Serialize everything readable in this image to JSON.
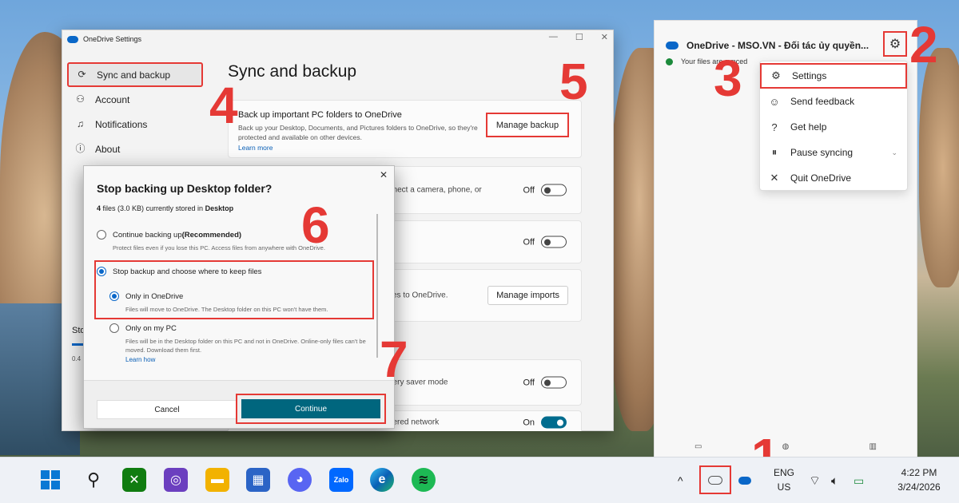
{
  "settings_window": {
    "title": "OneDrive Settings",
    "nav": [
      {
        "label": "Sync and backup",
        "icon": "sync-icon"
      },
      {
        "label": "Account",
        "icon": "person-icon"
      },
      {
        "label": "Notifications",
        "icon": "bell-icon"
      },
      {
        "label": "About",
        "icon": "info-icon"
      }
    ],
    "page_title": "Sync and backup",
    "backup_card": {
      "heading": "Back up important PC folders to OneDrive",
      "description": "Back up your Desktop, Documents, and Pictures folders to OneDrive, so they're protected and available on other devices.",
      "learn_more": "Learn more",
      "button": "Manage backup"
    },
    "rows": [
      {
        "text": "nnect a camera, phone, or",
        "state": "Off"
      },
      {
        "text": "",
        "state": "Off"
      },
      {
        "text": "ces to OneDrive.",
        "button": "Manage imports"
      },
      {
        "text": "ttery saver mode",
        "state": "Off"
      },
      {
        "text": "Pause syncing when this device is on a metered network",
        "state": "On"
      }
    ],
    "storage_label": "Sto",
    "storage_num": "0.4"
  },
  "dialog": {
    "title": "Stop backing up Desktop folder?",
    "info_count": "4",
    "info_rest": " files (3.0 KB) currently stored in ",
    "info_folder": "Desktop",
    "opt_continue": "Continue backing up",
    "opt_continue_rec": " (Recommended)",
    "opt_continue_desc": "Protect files even if you lose this PC. Access files from anywhere with OneDrive.",
    "opt_stop": "Stop backup and choose where to keep files",
    "opt_only_onedrive": "Only in OneDrive",
    "opt_only_onedrive_desc": "Files will move to OneDrive. The Desktop folder on this PC won't have them.",
    "opt_only_pc": "Only on my PC",
    "opt_only_pc_desc": "Files will be in the Desktop folder on this PC and not in OneDrive. Online-only files can't be moved. Download them first.",
    "learn_how": "Learn how",
    "cancel": "Cancel",
    "continue": "Continue"
  },
  "flyout": {
    "title": "OneDrive - MSO.VN - Đối tác ủy quyền...",
    "status": "Your files are synced",
    "menu": [
      {
        "label": "Settings",
        "icon": "gear-icon"
      },
      {
        "label": "Send feedback",
        "icon": "feedback-icon"
      },
      {
        "label": "Get help",
        "icon": "help-icon"
      },
      {
        "label": "Pause syncing",
        "icon": "pause-icon"
      },
      {
        "label": "Quit OneDrive",
        "icon": "close-icon"
      }
    ]
  },
  "steps": [
    "1",
    "2",
    "3",
    "4",
    "5",
    "6",
    "7"
  ],
  "taskbar": {
    "lang_top": "ENG",
    "lang_bottom": "US",
    "time": "4:22 PM",
    "date": "3/24/2026"
  }
}
